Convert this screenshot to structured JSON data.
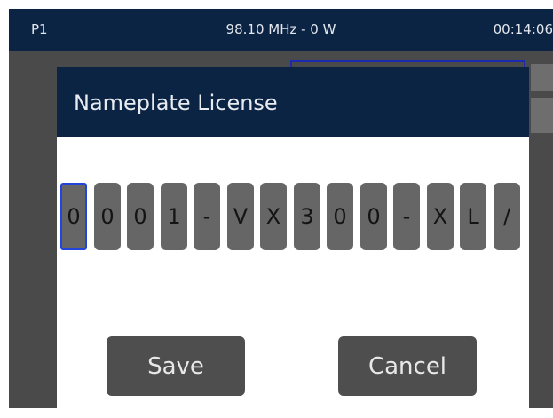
{
  "status_bar": {
    "profile": "P1",
    "frequency_power": "98.10 MHz - 0 W",
    "time": "00:14:06"
  },
  "dialog": {
    "title": "Nameplate License",
    "license_chars": [
      "0",
      "0",
      "0",
      "1",
      "-",
      "V",
      "X",
      "3",
      "0",
      "0",
      "-",
      "X",
      "L",
      "/"
    ],
    "selected_index": 0,
    "save_label": "Save",
    "cancel_label": "Cancel"
  },
  "colors": {
    "header_bg": "#0c2444",
    "screen_bg": "#4a4a4a",
    "selection": "#2244dd",
    "cell_bg": "#666666"
  }
}
